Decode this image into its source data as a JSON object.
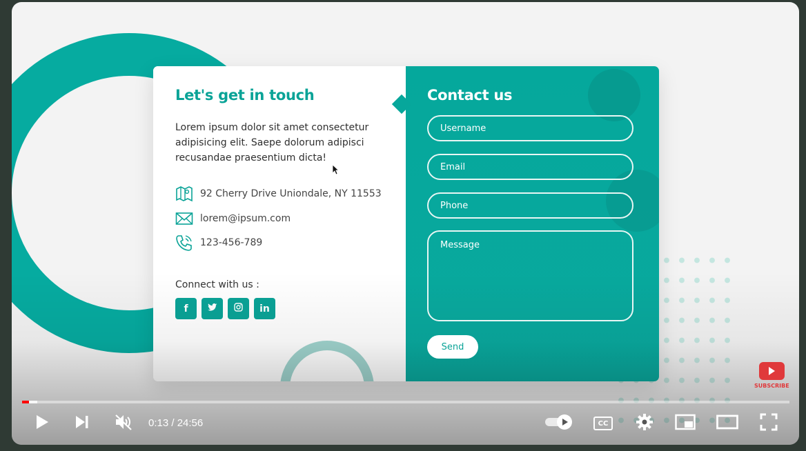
{
  "card": {
    "left": {
      "title": "Let's get in touch",
      "description": "Lorem ipsum dolor sit amet consectetur adipisicing elit. Saepe dolorum adipisci recusandae praesentium dicta!",
      "address": "92 Cherry Drive Uniondale, NY 11553",
      "email": "lorem@ipsum.com",
      "phone": "123-456-789",
      "connect_label": "Connect with us :",
      "social": [
        {
          "name": "facebook",
          "glyph": "f"
        },
        {
          "name": "twitter",
          "glyph": "t"
        },
        {
          "name": "instagram",
          "glyph": "◎"
        },
        {
          "name": "linkedin",
          "glyph": "in"
        }
      ]
    },
    "right": {
      "title": "Contact us",
      "fields": {
        "username": "Username",
        "email": "Email",
        "phone": "Phone",
        "message": "Message"
      },
      "send_label": "Send"
    }
  },
  "player": {
    "time": "0:13 / 24:56",
    "progress_fraction": 0.009,
    "buffered_fraction": 0.02,
    "subscribe_label": "SUBSCRIBE",
    "cc_label": "CC"
  },
  "colors": {
    "accent": "#0aa397",
    "progress": "#ff0000",
    "subscribe": "#e0393b"
  }
}
